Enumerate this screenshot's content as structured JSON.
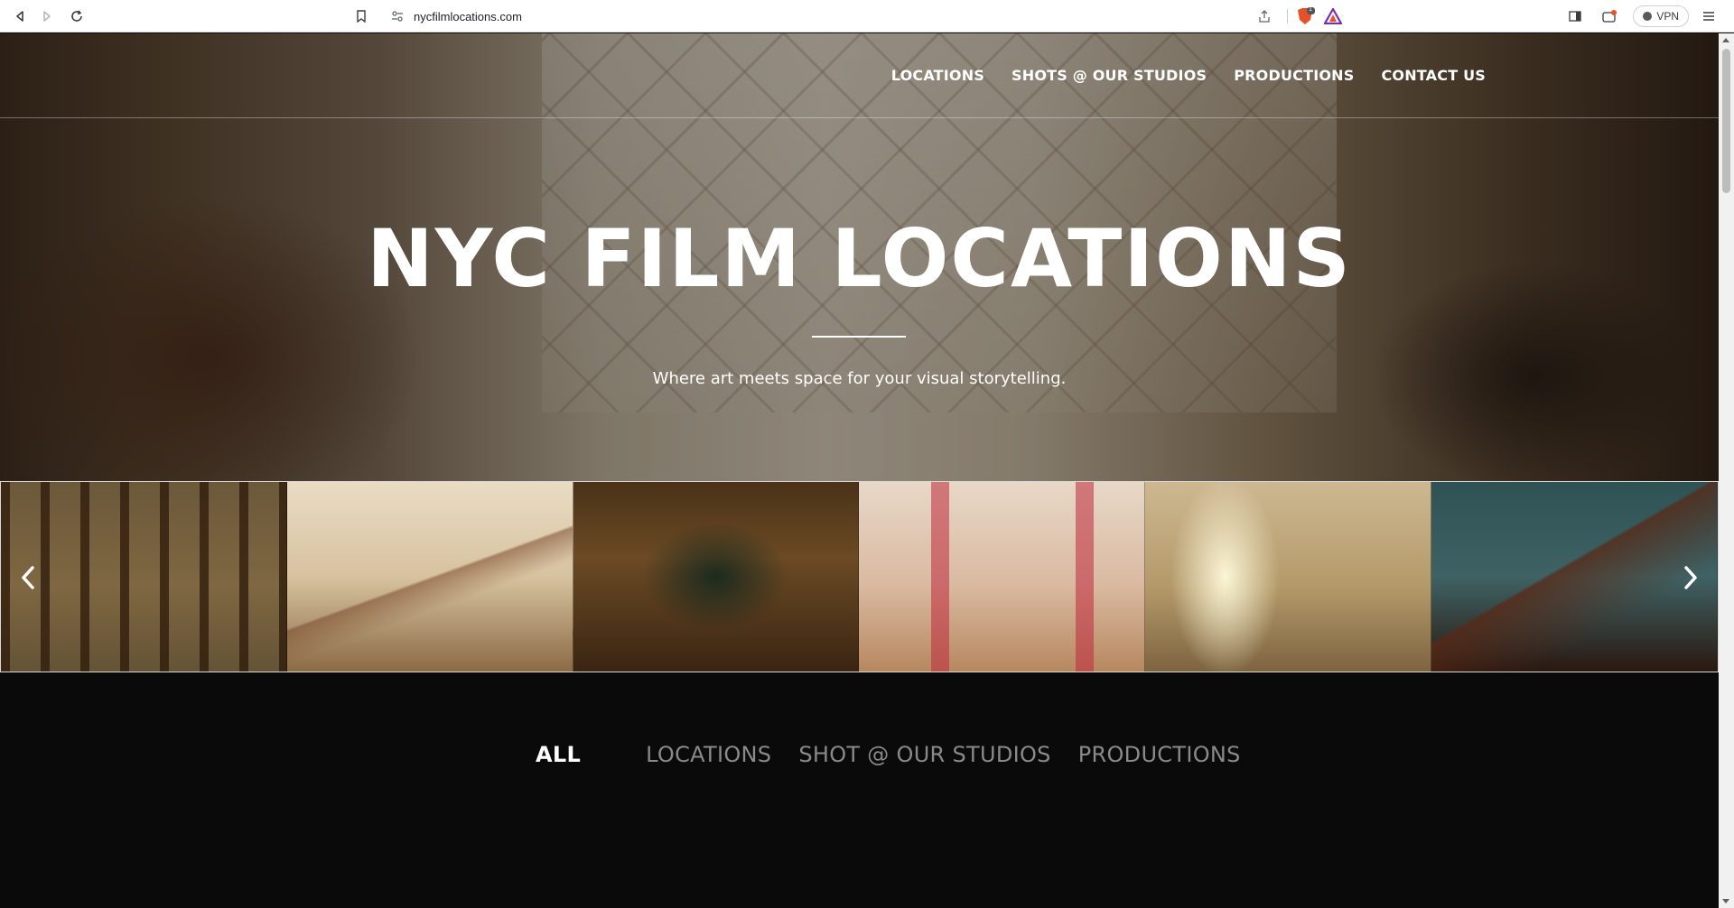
{
  "browser": {
    "url": "nycfilmlocations.com",
    "brave_badge": "1",
    "vpn_label": "VPN"
  },
  "nav": {
    "items": [
      {
        "label": "LOCATIONS"
      },
      {
        "label": "SHOTS @ OUR STUDIOS"
      },
      {
        "label": "PRODUCTIONS"
      },
      {
        "label": "CONTACT US"
      }
    ]
  },
  "hero": {
    "title": "NYC FILM LOCATIONS",
    "subtitle": "Where art meets space for your visual storytelling."
  },
  "carousel": {
    "prev_icon": "chevron-left-icon",
    "next_icon": "chevron-right-icon"
  },
  "filters": {
    "tabs": [
      {
        "label": "ALL",
        "active": true
      },
      {
        "label": "LOCATIONS",
        "active": false
      },
      {
        "label": "SHOT @ OUR STUDIOS",
        "active": false
      },
      {
        "label": "PRODUCTIONS",
        "active": false
      }
    ]
  },
  "colors": {
    "active_tab": "#ffffff",
    "inactive_tab": "#8a8a8a",
    "section_bg": "#0a0a0a"
  }
}
